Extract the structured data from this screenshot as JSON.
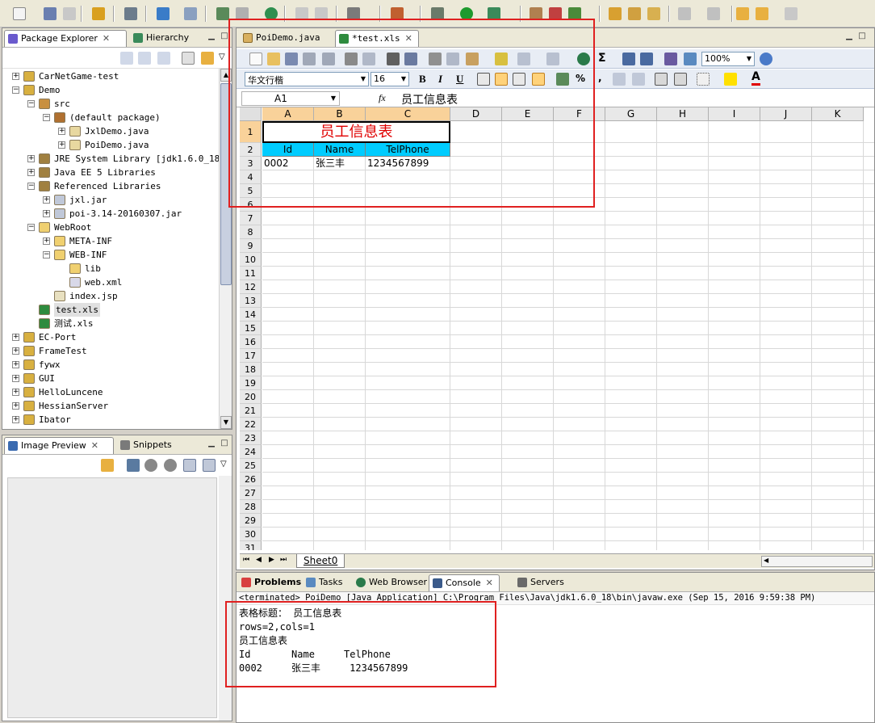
{
  "explorer": {
    "tabs": [
      "Package Explorer",
      "Hierarchy"
    ],
    "tree": [
      {
        "label": "CarNetGame-test",
        "indent": 0,
        "exp": "+",
        "icon": "project-icon"
      },
      {
        "label": "Demo",
        "indent": 0,
        "exp": "-",
        "icon": "project-icon"
      },
      {
        "label": "src",
        "indent": 1,
        "exp": "-",
        "icon": "source-folder-icon"
      },
      {
        "label": "(default package)",
        "indent": 2,
        "exp": "-",
        "icon": "package-icon"
      },
      {
        "label": "JxlDemo.java",
        "indent": 3,
        "exp": "+",
        "icon": "java-file-icon"
      },
      {
        "label": "PoiDemo.java",
        "indent": 3,
        "exp": "+",
        "icon": "java-file-icon"
      },
      {
        "label": "JRE System Library [jdk1.6.0_18]",
        "indent": 1,
        "exp": "+",
        "icon": "library-icon"
      },
      {
        "label": "Java EE 5 Libraries",
        "indent": 1,
        "exp": "+",
        "icon": "library-icon"
      },
      {
        "label": "Referenced Libraries",
        "indent": 1,
        "exp": "-",
        "icon": "library-icon"
      },
      {
        "label": "jxl.jar",
        "indent": 2,
        "exp": "+",
        "icon": "jar-icon"
      },
      {
        "label": "poi-3.14-20160307.jar",
        "indent": 2,
        "exp": "+",
        "icon": "jar-icon"
      },
      {
        "label": "WebRoot",
        "indent": 1,
        "exp": "-",
        "icon": "folder-icon"
      },
      {
        "label": "META-INF",
        "indent": 2,
        "exp": "+",
        "icon": "folder-icon"
      },
      {
        "label": "WEB-INF",
        "indent": 2,
        "exp": "-",
        "icon": "folder-icon"
      },
      {
        "label": "lib",
        "indent": 3,
        "exp": "",
        "icon": "folder-icon"
      },
      {
        "label": "web.xml",
        "indent": 3,
        "exp": "",
        "icon": "xml-file-icon"
      },
      {
        "label": "index.jsp",
        "indent": 2,
        "exp": "",
        "icon": "jsp-file-icon"
      },
      {
        "label": "test.xls",
        "indent": 1,
        "exp": "",
        "icon": "excel-file-icon",
        "selected": true
      },
      {
        "label": "测试.xls",
        "indent": 1,
        "exp": "",
        "icon": "excel-file-icon"
      },
      {
        "label": "EC-Port",
        "indent": 0,
        "exp": "+",
        "icon": "project-icon"
      },
      {
        "label": "FrameTest",
        "indent": 0,
        "exp": "+",
        "icon": "project-icon"
      },
      {
        "label": "fywx",
        "indent": 0,
        "exp": "+",
        "icon": "project-icon"
      },
      {
        "label": "GUI",
        "indent": 0,
        "exp": "+",
        "icon": "project-icon"
      },
      {
        "label": "HelloLuncene",
        "indent": 0,
        "exp": "+",
        "icon": "project-icon"
      },
      {
        "label": "HessianServer",
        "indent": 0,
        "exp": "+",
        "icon": "project-icon"
      },
      {
        "label": "Ibator",
        "indent": 0,
        "exp": "+",
        "icon": "project-icon"
      }
    ]
  },
  "preview": {
    "tabs": [
      "Image Preview",
      "Snippets"
    ]
  },
  "editor": {
    "tabs": [
      "PoiDemo.java",
      "*test.xls"
    ],
    "font_name": "华文行楷",
    "font_size": "16",
    "zoom": "100%",
    "name_box": "A1",
    "fx": "fx",
    "formula": "员工信息表",
    "columns": [
      "A",
      "B",
      "C",
      "D",
      "E",
      "F",
      "G",
      "H",
      "I",
      "J",
      "K"
    ],
    "rows": [
      "1",
      "2",
      "3",
      "4",
      "5",
      "6",
      "7",
      "8",
      "9",
      "10",
      "11",
      "12",
      "13",
      "14",
      "15",
      "16",
      "17",
      "18",
      "19",
      "20",
      "21",
      "22",
      "23",
      "24",
      "25",
      "26",
      "27",
      "28",
      "29",
      "30",
      "31"
    ],
    "title_cell": "员工信息表",
    "header": [
      "Id",
      "Name",
      "TelPhone"
    ],
    "data_row": [
      "0002",
      "张三丰",
      "1234567899"
    ],
    "sheet_tab": "Sheet0",
    "title_color": "#e00000",
    "header_color": "#00ccff"
  },
  "bottom": {
    "tabs": [
      "Problems",
      "Tasks",
      "Web Browser",
      "Console",
      "Servers"
    ],
    "terminated": "<terminated> PoiDemo [Java Application] C:\\Program Files\\Java\\jdk1.6.0_18\\bin\\javaw.exe (Sep 15, 2016 9:59:38 PM)",
    "lines": [
      "表格标题： 员工信息表",
      "rows=2,cols=1",
      "员工信息表",
      "Id       Name     TelPhone",
      "0002     张三丰     1234567899"
    ]
  }
}
